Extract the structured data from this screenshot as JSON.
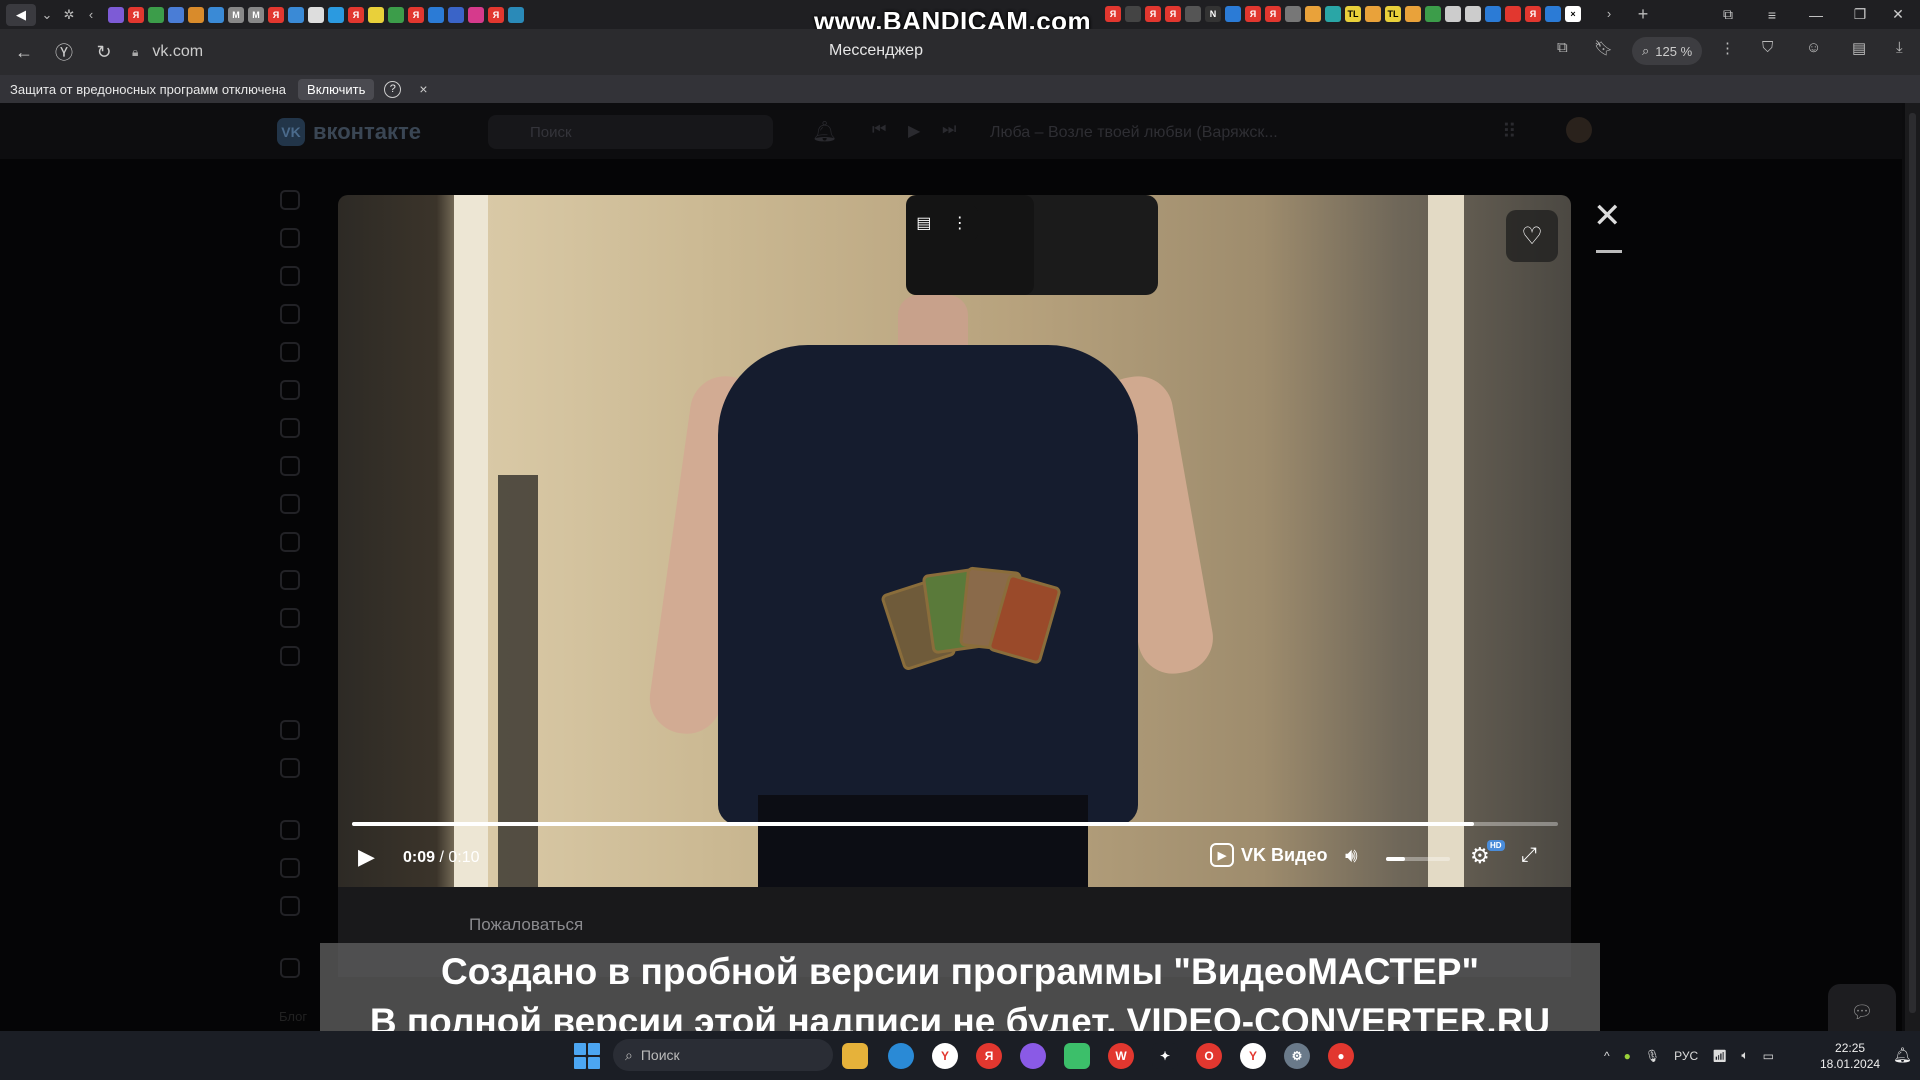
{
  "tabstrip": {
    "watermark": "www.BANDICAM.com"
  },
  "addressbar": {
    "url": "vk.com",
    "page_title": "Мессенджер",
    "zoom": "125 %"
  },
  "protection_bar": {
    "message": "Защита от вредоносных программ отключена",
    "enable_label": "Включить",
    "help": "?",
    "close": "×"
  },
  "vk": {
    "logo_text": "вконтакте",
    "logo_mark": "VK",
    "search_placeholder": "Поиск",
    "now_playing": "Люба – Возле твоей любви (Варяжск...",
    "blog_link": "Блог"
  },
  "player": {
    "current_time": "0:09",
    "duration": "0:10",
    "time_separator": " / ",
    "progress_fraction": 0.93,
    "volume_fraction": 0.3,
    "brand_label": "VK Видео",
    "hd_badge": "HD",
    "complain_label": "Пожаловаться"
  },
  "watermark": {
    "line1": "Создано в пробной версии программы \"ВидеоМАСТЕР\"",
    "line2": "В полной версии этой надписи не будет. VIDEO-CONVERTER.RU"
  },
  "taskbar": {
    "search_placeholder": "Поиск",
    "language": "РУС",
    "time": "22:25",
    "date": "18.01.2024"
  },
  "colors": {
    "accent": "#4ca6f2",
    "hd_badge": "#4a8cd9"
  }
}
